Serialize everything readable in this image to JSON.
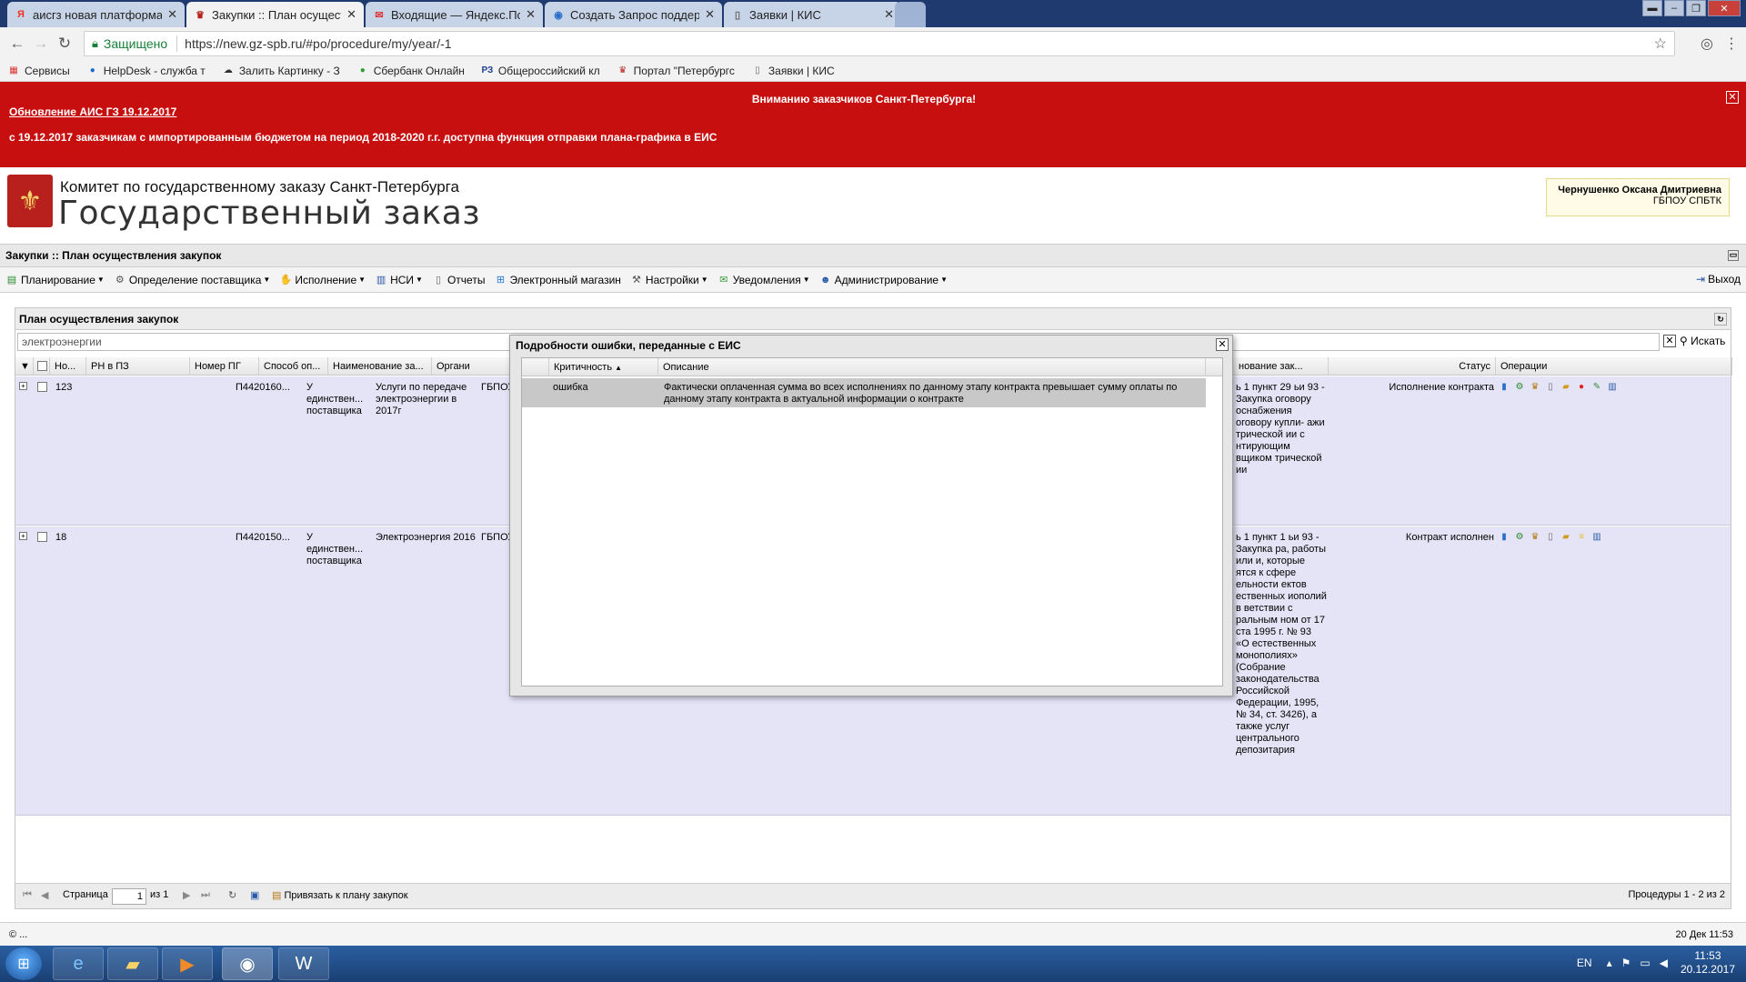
{
  "browser": {
    "tabs": [
      {
        "title": "аисгз новая платформа",
        "icon": "yandex-icon"
      },
      {
        "title": "Закупки :: План осущест",
        "icon": "spb-crest-icon",
        "active": true
      },
      {
        "title": "Входящие — Яндекс.По",
        "icon": "mail-icon"
      },
      {
        "title": "Создать Запрос поддер",
        "icon": "globe-icon"
      },
      {
        "title": "Заявки | КИС",
        "icon": "document-icon"
      }
    ],
    "secure_label": "Защищено",
    "url": "https://new.gz-spb.ru/#po/procedure/my/year/-1",
    "bookmarks": [
      {
        "label": "Сервисы",
        "icon": "apps-icon"
      },
      {
        "label": "HelpDesk - служба т",
        "icon": "helpdesk-icon"
      },
      {
        "label": "Залить Картинку - З",
        "icon": "image-icon"
      },
      {
        "label": "Сбербанк Онлайн",
        "icon": "sberbank-icon"
      },
      {
        "label": "Общероссийский кл",
        "icon": "classifier-icon"
      },
      {
        "label": "Портал \"Петербургс",
        "icon": "portal-icon"
      },
      {
        "label": "Заявки | КИС",
        "icon": "document-icon"
      }
    ]
  },
  "notice": {
    "title": "Вниманию заказчиков Санкт-Петербурга!",
    "link": "Обновление АИС ГЗ 19.12.2017",
    "text": "с 19.12.2017 заказчикам с импортированным бюджетом на период 2018-2020 г.г.  доступна функция отправки плана-графика  в ЕИС",
    "bg_color": "#c80f0f"
  },
  "header": {
    "org": "Комитет по государственному заказу Санкт-Петербурга",
    "brand": "Государственный заказ",
    "user_name": "Чернушенко Оксана Дмитриевна",
    "user_org": "ГБПОУ СПБТК"
  },
  "panel_title": "Закупки :: План осуществления закупок",
  "menu": {
    "items": [
      {
        "label": "Планирование",
        "icon": "planning-icon"
      },
      {
        "label": "Определение поставщика",
        "icon": "gear-icon"
      },
      {
        "label": "Исполнение",
        "icon": "handshake-icon"
      },
      {
        "label": "НСИ",
        "icon": "book-icon"
      },
      {
        "label": "Отчеты",
        "icon": "report-icon"
      },
      {
        "label": "Электронный магазин",
        "icon": "cart-icon"
      },
      {
        "label": "Настройки",
        "icon": "wrench-icon"
      },
      {
        "label": "Уведомления",
        "icon": "envelope-icon"
      },
      {
        "label": "Администрирование",
        "icon": "user-icon"
      }
    ],
    "exit": "Выход"
  },
  "grid": {
    "title": "План осуществления закупок",
    "search_value": "электроэнергии",
    "search_button": "Искать",
    "columns": {
      "num": "Но...",
      "rn": "РН в ПЗ",
      "pg": "Номер ПГ",
      "method": "Способ оп...",
      "name": "Наименование за...",
      "org": "Органи",
      "basis": "нование зак...",
      "status": "Статус",
      "ops": "Операции"
    },
    "rows": [
      {
        "num": "123",
        "pg": "П4420160...",
        "method": "У единствен... поставщика",
        "name": "Услуги по передаче электроэнергии в 2017г",
        "org": "ГБПОУ",
        "basis": "ь 1 пункт 29 ьи 93 - Закупка оговору оснабжения оговору купли- ажи трической ии с нтирующим вщиком трической ии",
        "status": "Исполнение контракта"
      },
      {
        "num": "18",
        "pg": "П4420150...",
        "method": "У единствен... поставщика",
        "name": "Электроэнергия 2016",
        "org": "ГБПОУ",
        "basis": "ь 1 пункт 1 ьи 93 - Закупка ра, работы или и, которые ятся к сфере ельности ектов ественных иополий в ветствии с ральным ном от 17 ста 1995 г. № 93 «О естественных монополиях» (Собрание законодательства Российской Федерации, 1995, № 34, ст. 3426), а также услуг центрального депозитария",
        "status": "Контракт исполнен"
      }
    ],
    "pager": {
      "page_label": "Страница",
      "page_value": "1",
      "of_label": "из 1",
      "bind_plan": "Привязать к плану закупок",
      "summary": "Процедуры 1 - 2 из 2"
    }
  },
  "modal": {
    "title": "Подробности ошибки, переданные с ЕИС",
    "col_criticality": "Критичность",
    "col_description": "Описание",
    "row_criticality": "ошибка",
    "row_description": "Фактически оплаченная сумма во всех исполнениях по данному этапу контракта превышает сумму оплаты по данному этапу контракта в актуальной информации о контракте"
  },
  "status_bar": {
    "left": "© ...",
    "right": "20 Дек 11:53"
  },
  "taskbar": {
    "lang": "EN",
    "time": "11:53",
    "date": "20.12.2017"
  }
}
